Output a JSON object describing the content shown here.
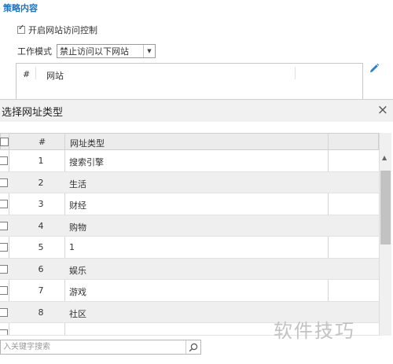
{
  "policy": {
    "section_title": "策略内容",
    "enable_label": "开启网站访问控制",
    "enable_checked": true,
    "mode_label": "工作模式",
    "mode_value": "禁止访问以下网站",
    "site_table_headers": [
      "#",
      "网站"
    ],
    "edit_icon": "pencil-icon"
  },
  "dialog": {
    "title": "选择网址类型",
    "close_icon": "×",
    "headers": {
      "num": "#",
      "type": "网址类型"
    },
    "rows": [
      {
        "num": "1",
        "name": "搜索引擎"
      },
      {
        "num": "2",
        "name": "生活"
      },
      {
        "num": "3",
        "name": "财经"
      },
      {
        "num": "4",
        "name": "购物"
      },
      {
        "num": "5",
        "name": "1"
      },
      {
        "num": "6",
        "name": "娱乐"
      },
      {
        "num": "7",
        "name": "游戏"
      },
      {
        "num": "8",
        "name": "社区"
      }
    ],
    "search_placeholder": "入关键字搜索",
    "search_icon": "search-icon"
  },
  "watermark": "软件技巧"
}
